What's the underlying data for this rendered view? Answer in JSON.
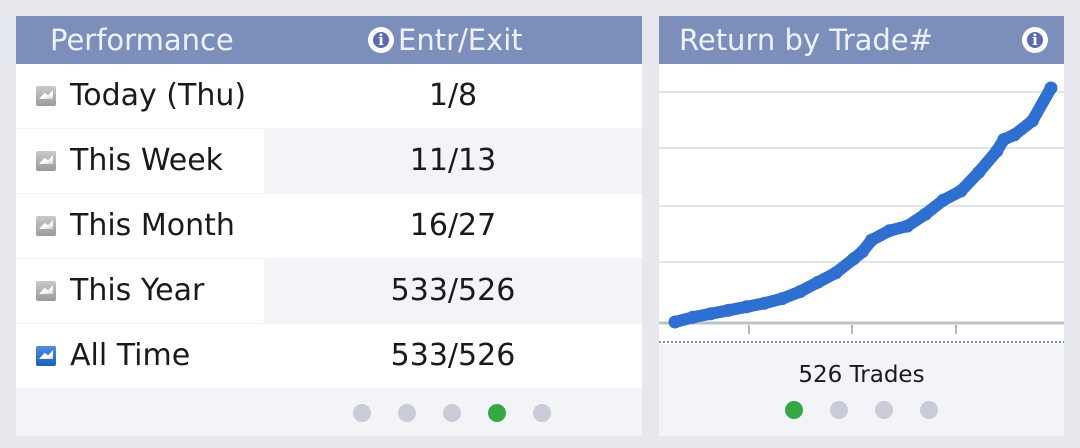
{
  "performance": {
    "header_label": "Performance",
    "entr_exit_label": "Entr/Exit",
    "rows": [
      {
        "label": "Today (Thu)",
        "value": "1/8",
        "active": false
      },
      {
        "label": "This Week",
        "value": "11/13",
        "active": false
      },
      {
        "label": "This Month",
        "value": "16/27",
        "active": false
      },
      {
        "label": "This Year",
        "value": "533/526",
        "active": false
      },
      {
        "label": "All Time",
        "value": "533/526",
        "active": true
      }
    ],
    "page_dots": {
      "count": 5,
      "active_index": 3
    }
  },
  "chart_panel": {
    "title": "Return by Trade#",
    "trades_label": "526 Trades",
    "page_dots": {
      "count": 4,
      "active_index": 0
    }
  },
  "colors": {
    "header_bg": "#7c8fbb",
    "line": "#2f6fcf",
    "active_dot": "#35a844",
    "inactive_dot": "#c9cbd8"
  },
  "icons": [
    "info-icon",
    "chart-mini-icon"
  ],
  "chart_data": {
    "type": "line",
    "xlabel": "",
    "ylabel": "",
    "xlim": [
      0,
      526
    ],
    "ylim": [
      0,
      1
    ],
    "grid": true,
    "series": [
      {
        "x": [
          0,
          25,
          50,
          75,
          100,
          125,
          150,
          175,
          200,
          225,
          250,
          262,
          275,
          300,
          325,
          350,
          375,
          400,
          425,
          450,
          460,
          475,
          500,
          526
        ],
        "values": [
          0.0,
          0.02,
          0.035,
          0.05,
          0.065,
          0.08,
          0.1,
          0.13,
          0.17,
          0.21,
          0.27,
          0.3,
          0.35,
          0.39,
          0.41,
          0.46,
          0.52,
          0.56,
          0.64,
          0.73,
          0.78,
          0.8,
          0.86,
          1.0
        ]
      }
    ]
  }
}
